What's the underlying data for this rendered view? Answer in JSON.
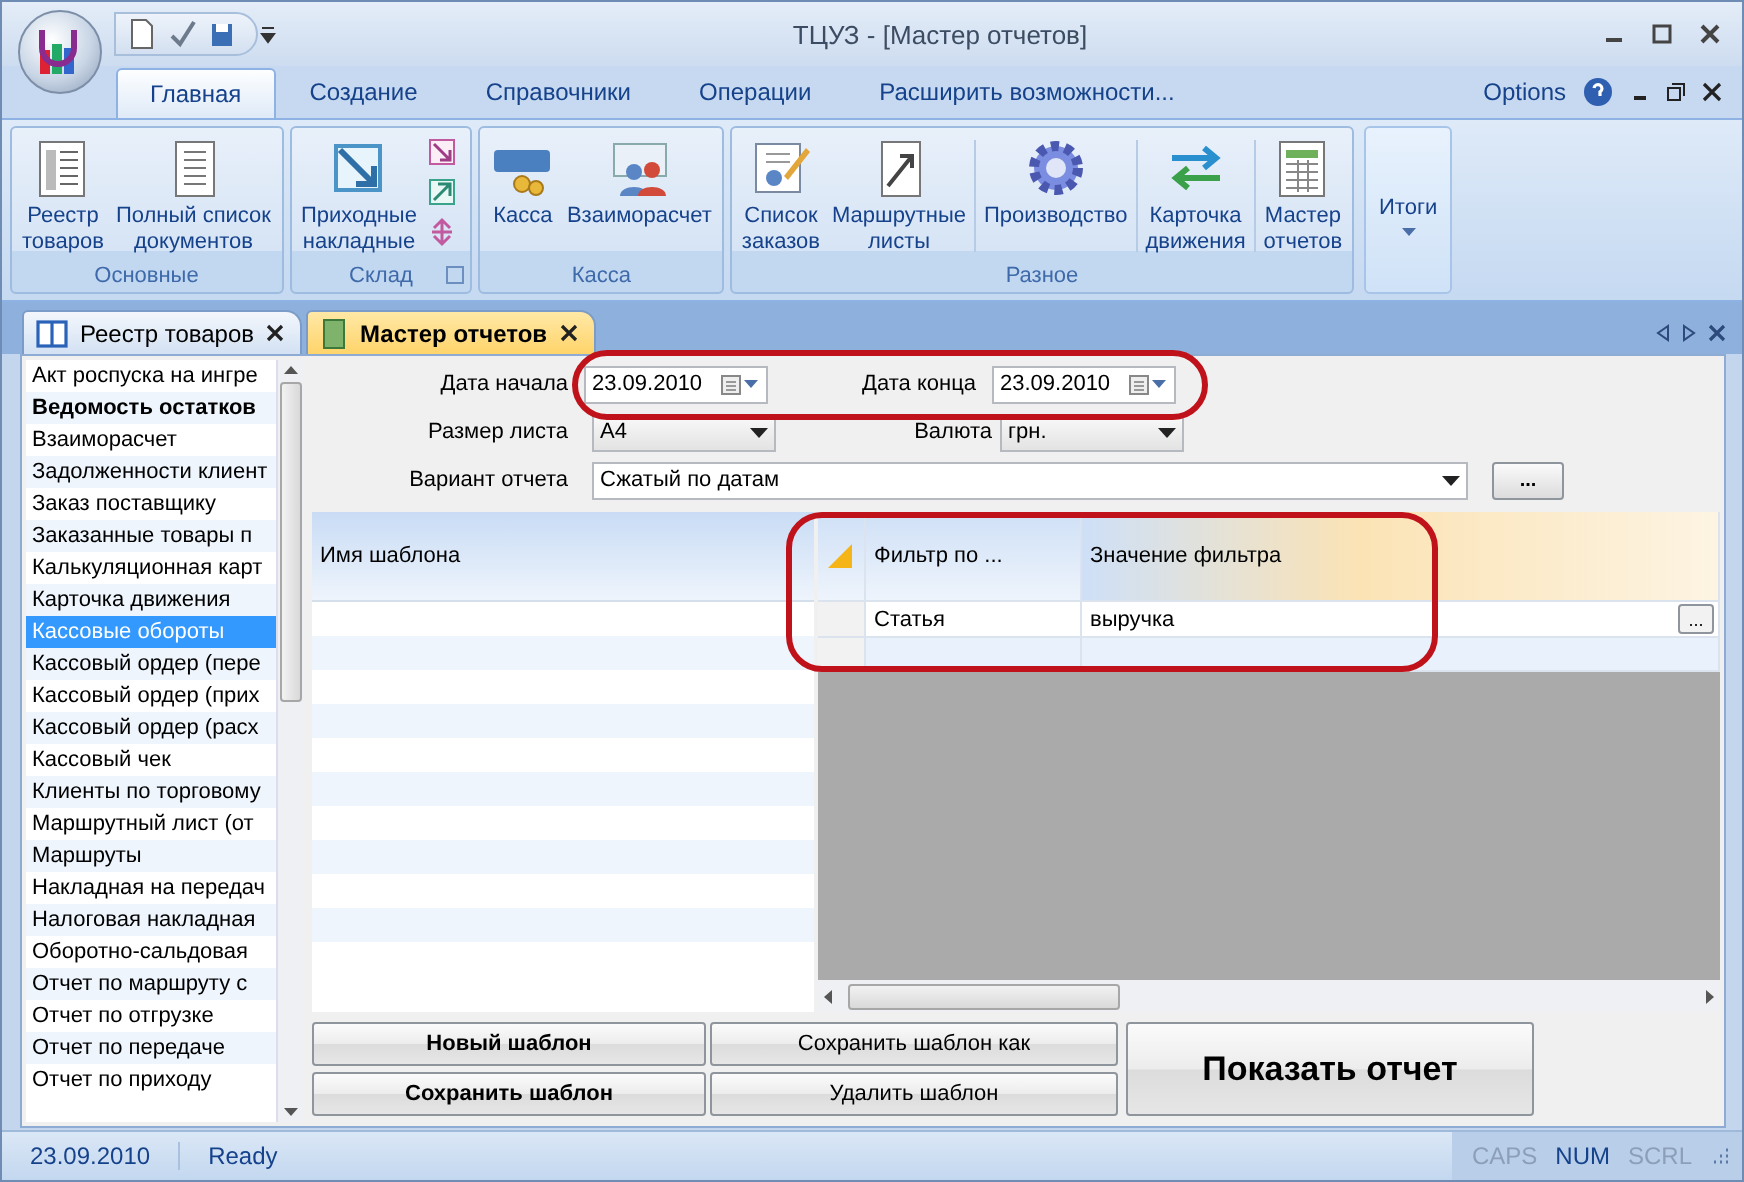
{
  "window": {
    "title": "ТЦУЗ - [Мастер отчетов]"
  },
  "ribbon": {
    "tabs": [
      {
        "label": "Главная",
        "selected": true
      },
      {
        "label": "Создание",
        "selected": false
      },
      {
        "label": "Справочники",
        "selected": false
      },
      {
        "label": "Операции",
        "selected": false
      },
      {
        "label": "Расширить возможности...",
        "selected": false
      }
    ],
    "options": "Options",
    "groups": [
      {
        "label": "Основные",
        "kind": "plain",
        "sections": [
          [
            {
              "label": "Реестр\nтоваров"
            },
            {
              "label": "Полный список\nдокументов"
            }
          ]
        ]
      },
      {
        "label": "Склад",
        "kind": "with_small",
        "sections": [
          [
            {
              "label": "Приходные\nнакладные"
            }
          ]
        ]
      },
      {
        "label": "Касса",
        "kind": "plain",
        "sections": [
          [
            {
              "label": "Касса"
            },
            {
              "label": "Взаиморасчет"
            }
          ]
        ]
      },
      {
        "label": "Разное",
        "kind": "plain",
        "sections": [
          [
            {
              "label": "Список\nзаказов"
            },
            {
              "label": "Маршрутные\nлисты"
            }
          ],
          [
            {
              "label": "Производство"
            }
          ],
          [
            {
              "label": "Карточка\nдвижения"
            }
          ],
          [
            {
              "label": "Мастер\nотчетов"
            }
          ]
        ]
      }
    ],
    "totals": {
      "label": "Итоги"
    }
  },
  "doc_tabs": [
    {
      "label": "Реестр товаров",
      "selected": false
    },
    {
      "label": "Мастер отчетов",
      "selected": true
    }
  ],
  "report_list": [
    {
      "label": "Акт роспуска на ингре",
      "selected": false,
      "bold": false
    },
    {
      "label": "Ведомость остатков",
      "selected": false,
      "bold": true
    },
    {
      "label": "Взаиморасчет",
      "selected": false,
      "bold": false
    },
    {
      "label": "Задолженности клиент",
      "selected": false,
      "bold": false
    },
    {
      "label": "Заказ поставщику",
      "selected": false,
      "bold": false
    },
    {
      "label": "Заказанные товары п",
      "selected": false,
      "bold": false
    },
    {
      "label": "Калькуляционная карт",
      "selected": false,
      "bold": false
    },
    {
      "label": "Карточка движения",
      "selected": false,
      "bold": false
    },
    {
      "label": "Кассовые обороты",
      "selected": true,
      "bold": false
    },
    {
      "label": "Кассовый ордер (пере",
      "selected": false,
      "bold": false
    },
    {
      "label": "Кассовый ордер (прих",
      "selected": false,
      "bold": false
    },
    {
      "label": "Кассовый ордер (расх",
      "selected": false,
      "bold": false
    },
    {
      "label": "Кассовый чек",
      "selected": false,
      "bold": false
    },
    {
      "label": "Клиенты по торговому",
      "selected": false,
      "bold": false
    },
    {
      "label": "Маршрутный лист (от",
      "selected": false,
      "bold": false
    },
    {
      "label": "Маршруты",
      "selected": false,
      "bold": false
    },
    {
      "label": "Накладная на передач",
      "selected": false,
      "bold": false
    },
    {
      "label": "Налоговая накладная",
      "selected": false,
      "bold": false
    },
    {
      "label": "Оборотно-сальдовая",
      "selected": false,
      "bold": false
    },
    {
      "label": "Отчет по маршруту с",
      "selected": false,
      "bold": false
    },
    {
      "label": "Отчет по отгрузке",
      "selected": false,
      "bold": false
    },
    {
      "label": "Отчет по передаче",
      "selected": false,
      "bold": false
    },
    {
      "label": "Отчет по приходу",
      "selected": false,
      "bold": false
    }
  ],
  "form": {
    "dates_highlighted": true,
    "start_date": {
      "label": "Дата начала",
      "value": "23.09.2010"
    },
    "end_date": {
      "label": "Дата конца",
      "value": "23.09.2010"
    },
    "sheet_size": {
      "label": "Размер листа",
      "value": "A4"
    },
    "currency": {
      "label": "Валюта",
      "value": "грн."
    },
    "variant": {
      "label": "Вариант отчета",
      "value": "Сжатый по датам",
      "more": "..."
    }
  },
  "templates": {
    "column": "Имя шаблона"
  },
  "filters": {
    "highlighted": true,
    "columns": [
      "Фильтр по ...",
      "Значение фильтра"
    ],
    "rows": [
      {
        "field": "Статья",
        "value": "выручка",
        "more": "..."
      }
    ]
  },
  "buttons": [
    {
      "label": "Новый шаблон",
      "bold": true
    },
    {
      "label": "Сохранить шаблон как",
      "bold": false
    },
    {
      "label": "Сохранить шаблон",
      "bold": true
    },
    {
      "label": "Удалить шаблон",
      "bold": false
    }
  ],
  "show_button": "Показать отчет",
  "status_bar": {
    "date": "23.09.2010",
    "message": "Ready",
    "indicators": [
      {
        "label": "CAPS",
        "on": false
      },
      {
        "label": "NUM",
        "on": true
      },
      {
        "label": "SCRL",
        "on": false
      }
    ]
  }
}
